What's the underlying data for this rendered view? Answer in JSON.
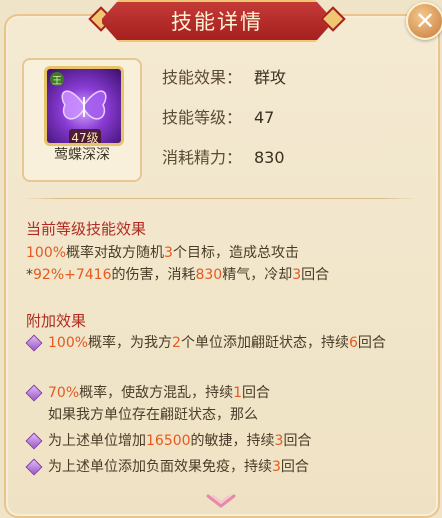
{
  "header": {
    "title": "技能详情"
  },
  "close_button": {
    "glyph": "✕"
  },
  "skill": {
    "name": "莺蝶深深",
    "level_tag": "47级",
    "badge": "王",
    "icon": "butterfly-icon"
  },
  "info_rows": [
    {
      "label": "技能效果：",
      "value": "群攻"
    },
    {
      "label": "技能等级：",
      "value": "47"
    },
    {
      "label": "消耗精力：",
      "value": "830"
    }
  ],
  "current_effect": {
    "title": "当前等级技能效果",
    "parts": {
      "a": "100%",
      "b": "概率对敌方随机",
      "c": "3",
      "d": "个目标，造成总攻击",
      "e": "*",
      "f": "92%+7416",
      "g": "的伤害，消耗",
      "h": "830",
      "i": "精气，冷却",
      "j": "3",
      "k": "回合"
    }
  },
  "extra_effect": {
    "title": "附加效果",
    "items": [
      {
        "p1": "100%",
        "p2": "概率，为我方",
        "p3": "2",
        "p4": "个单位添加翩跹状态，持续",
        "p5": "6",
        "p6": "回合"
      },
      {
        "p1": "70%",
        "p2": "概率，使敌方混乱，持续",
        "p3": "1",
        "p4": "回合",
        "p5": "如果我方单位存在翩跹状态，那么"
      },
      {
        "p1": "为上述单位增加",
        "p2": "16500",
        "p3": "的敏捷，持续",
        "p4": "3",
        "p5": "回合"
      },
      {
        "p1": "为上述单位添加负面效果免疫，持续",
        "p2": "3",
        "p3": "回合"
      }
    ]
  },
  "colors": {
    "highlight": "#e55a1e",
    "section_title": "#b22b22",
    "accent": "#c43a37"
  },
  "scroll_indicator": "chevron-down-icon"
}
